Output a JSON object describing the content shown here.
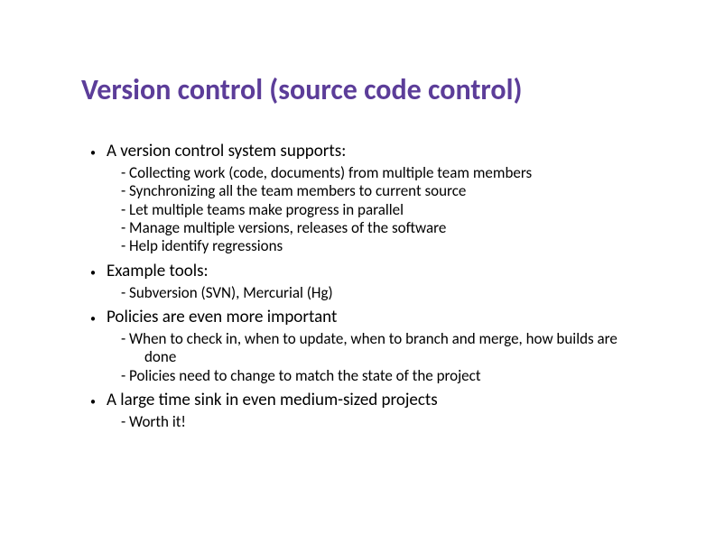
{
  "title": "Version control (source code control)",
  "bullets": [
    {
      "text": "A version control system supports:",
      "subs": [
        "- Collecting work (code, documents) from multiple team members",
        "- Synchronizing all the team members to current source",
        "- Let multiple teams make progress in parallel",
        "- Manage multiple versions, releases of the software",
        "- Help identify regressions"
      ]
    },
    {
      "text": "Example tools:",
      "subs": [
        "- Subversion (SVN), Mercurial (Hg)"
      ]
    },
    {
      "text": "Policies are even more important",
      "subs": [
        "- When to check in, when to update, when to branch and merge, how builds are done",
        "- Policies need to change to match the state of the project"
      ]
    },
    {
      "text": "A large time sink in even medium-sized projects",
      "subs": [
        "- Worth it!"
      ]
    }
  ]
}
